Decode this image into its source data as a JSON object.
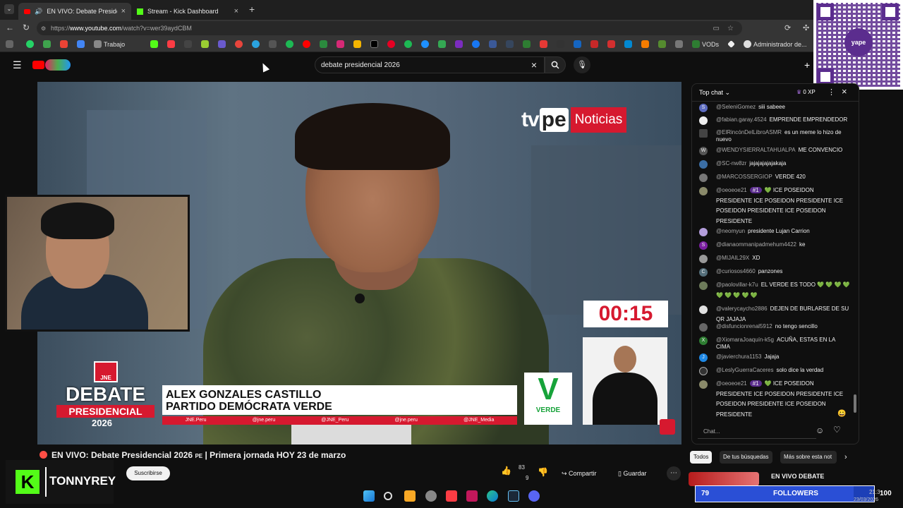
{
  "browser": {
    "tabs": [
      {
        "label": "EN VIVO: Debate Presiden",
        "active": true
      },
      {
        "label": "Stream - Kick Dashboard",
        "active": false
      }
    ],
    "new_tab": "+",
    "url_prefix": "https://",
    "url_host": "www.youtube.com",
    "url_path": "/watch?v=wer39aydCBM",
    "bookmarks": {
      "trabajo": "Trabajo",
      "vods": "VODs",
      "admin": "Administrador de..."
    }
  },
  "youtube": {
    "search_query": "debate presidencial 2026",
    "video_title": "EN VIVO: Debate Presidencial 2026",
    "video_title_rest": "| Primera jornada HOY 23 de marzo",
    "subscribe_label": "Suscribirse",
    "likes": "83",
    "dislikes_count": "9",
    "share_label": "Compartir",
    "save_label": "Guardar",
    "chips": [
      "Todos",
      "De tus búsquedas",
      "Más sobre esta not"
    ],
    "related_title": "EN VIVO DEBATE"
  },
  "broadcast": {
    "channel_logo_tv": "tv",
    "channel_logo_pe": "pe",
    "channel_logo_noticias": "Noticias",
    "jne": "JNE",
    "debate_word": "DEBATE",
    "presidencial_word": "PRESIDENCIAL",
    "year": "2026",
    "candidate_name": "ALEX GONZALES CASTILLO",
    "party_name": "PARTIDO DEMÓCRATA VERDE",
    "socials": [
      "JNE.Peru",
      "@jne.peru",
      "@JNE_Peru",
      "@jne.peru",
      "@JNE_Media"
    ],
    "timer": "00:15",
    "party_logo_letter": "V",
    "party_logo_word": "VERDE"
  },
  "chat": {
    "header": "Top chat",
    "xp": "0 XP",
    "placeholder": "Chat...",
    "messages": [
      {
        "user": "@SeleniGomez",
        "text": "siii sabeee",
        "av": "S"
      },
      {
        "user": "@fabian.garay.4524",
        "text": "EMPRENDE EMPRENDEDOR",
        "av": ""
      },
      {
        "user": "@ElRincónDelLibroASMR",
        "text": "es un meme lo hizo de nuevo",
        "av": ""
      },
      {
        "user": "@WENDYSIERRALTAHUALPA",
        "text": "ME CONVENCIO",
        "av": "W"
      },
      {
        "user": "@SC-nw8zr",
        "text": "jajajajajajakaja",
        "av": ""
      },
      {
        "user": "@MARCOSSERGIOP",
        "text": "VERDE 420",
        "av": ""
      },
      {
        "user": "@oeoeoe21",
        "badge": "#1",
        "text": "ICE POSEIDON PRESIDENTE ICE POSEIDON PRESIDENTE ICE POSEIDON PRESIDENTE ICE POSEIDON PRESIDENTE",
        "av": ""
      },
      {
        "user": "@neomyun",
        "text": "presidente Lujan Carrion",
        "av": ""
      },
      {
        "user": "@dianaommanipadmehum4422",
        "text": "ke",
        "av": "S"
      },
      {
        "user": "@MIJAIL29X",
        "text": "XD",
        "av": ""
      },
      {
        "user": "@curiosos4660",
        "text": "panzones",
        "av": "C"
      },
      {
        "user": "@paolovillar-k7u",
        "text": "EL VERDE ES TODO",
        "av": ""
      },
      {
        "user": "@valerycaycho2886",
        "text": "DEJEN DE BURLARSE DE SU QR JAJAJA",
        "av": ""
      },
      {
        "user": "@disfuncionrenal5912",
        "text": "no tengo sencillo",
        "av": ""
      },
      {
        "user": "@XiomaraJoaquín-k5g",
        "text": "ACUÑA, ESTAS EN LA CIMA",
        "av": "X"
      },
      {
        "user": "@javierchura1153",
        "text": "Jajaja",
        "av": "J"
      },
      {
        "user": "@LeslyGuerraCaceres",
        "text": "solo dice la verdad",
        "av": ""
      },
      {
        "user": "@oeoeoe21",
        "badge": "#1",
        "text": "ICE POSEIDON PRESIDENTE ICE POSEIDON PRESIDENTE ICE POSEIDON PRESIDENTE ICE POSEIDON PRESIDENTE",
        "av": ""
      }
    ]
  },
  "overlays": {
    "kick_name": "TONNYREY",
    "followers_count": "79",
    "followers_label": "FOLLOWERS",
    "qr_brand": "yape"
  },
  "taskbar": {
    "time": "21:3",
    "date": "23/03/2026",
    "tray_num": "100"
  },
  "colors": {
    "youtube_red": "#ff0000",
    "tvpe_red": "#d6192f",
    "kick_green": "#53fc18",
    "verde": "#17a33a",
    "followers_blue": "#1c3fb7"
  }
}
